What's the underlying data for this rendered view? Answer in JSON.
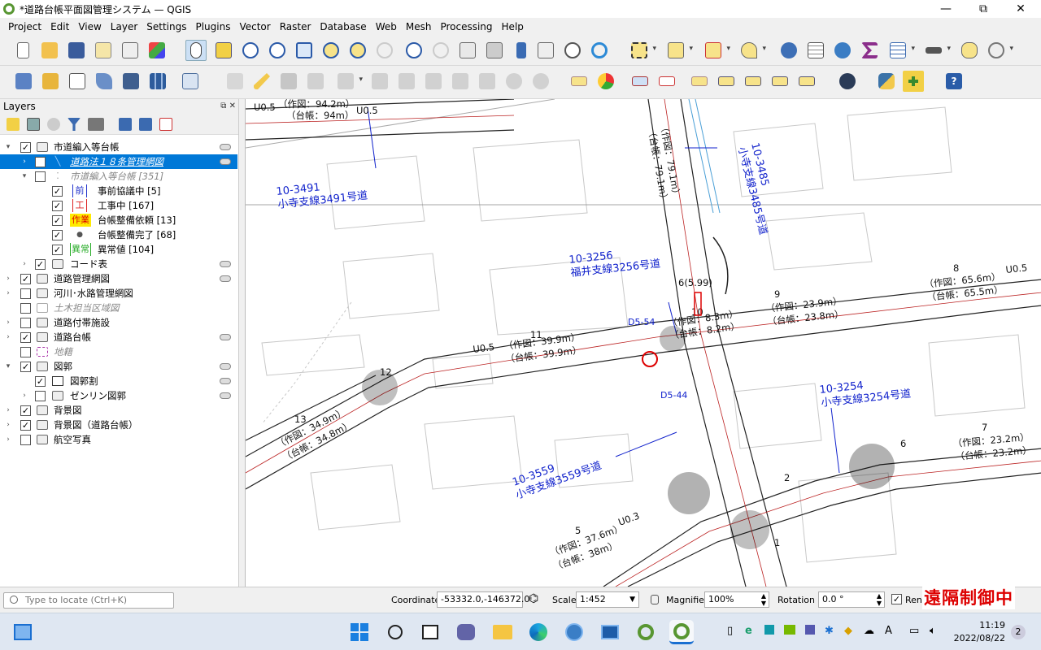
{
  "window": {
    "title": "*道路台帳平面図管理システム — QGIS",
    "minimize": "—",
    "maximize": "⧉",
    "close": "✕"
  },
  "menu": [
    "Project",
    "Edit",
    "View",
    "Layer",
    "Settings",
    "Plugins",
    "Vector",
    "Raster",
    "Database",
    "Web",
    "Mesh",
    "Processing",
    "Help"
  ],
  "layers_panel": {
    "title": "Layers",
    "items": [
      {
        "label": "市道編入等台帳",
        "checked": true
      },
      {
        "label": "道路法１８条管理網図",
        "checked": false
      },
      {
        "label": "市道編入等台帳 [351]",
        "checked": false
      },
      {
        "label": "事前協議中 [5]",
        "checked": true,
        "symbol": "前"
      },
      {
        "label": "工事中 [167]",
        "checked": true,
        "symbol": "工"
      },
      {
        "label": "台帳整備依頼 [13]",
        "checked": true,
        "symbol": "作業"
      },
      {
        "label": "台帳整備完了 [68]",
        "checked": true,
        "symbol": "●"
      },
      {
        "label": "異常値 [104]",
        "checked": true,
        "symbol": "異常"
      },
      {
        "label": "コード表",
        "checked": true
      },
      {
        "label": "道路管理網図",
        "checked": true
      },
      {
        "label": "河川･水路管理網図",
        "checked": false
      },
      {
        "label": "土木担当区域図",
        "checked": false
      },
      {
        "label": "道路付帯施設",
        "checked": false
      },
      {
        "label": "道路台帳",
        "checked": true
      },
      {
        "label": "地籍",
        "checked": false
      },
      {
        "label": "図郭",
        "checked": true
      },
      {
        "label": "図郭割",
        "checked": true
      },
      {
        "label": "ゼンリン図郭",
        "checked": false
      },
      {
        "label": "背景図",
        "checked": true
      },
      {
        "label": "背景図（道路台帳）",
        "checked": true
      },
      {
        "label": "航空写真",
        "checked": false
      }
    ]
  },
  "map": {
    "labels": {
      "road_3491_code": "10-3491",
      "road_3491_name": "小寺支線3491号道",
      "road_3485_code": "10-3485",
      "road_3485_name": "小寺支線3485号道",
      "road_3256_code": "10-3256",
      "road_3256_name": "福井支線3256号道",
      "road_3254_code": "10-3254",
      "road_3254_name": "小寺支線3254号道",
      "road_3559_code": "10-3559",
      "road_3559_name": "小寺支線3559号道",
      "u05_top": "U0.5",
      "sakuzu_94": "（作図：94.2m）",
      "daicho_94": "（台帳：94m）",
      "sakuzu_39": "（作図：39.9m）",
      "daicho_39": "（台帳：39.9m）",
      "u05_mid": "U0.5",
      "sakuzu_23": "（作図：23.9m）",
      "daicho_23": "（台帳：23.8m）",
      "sakuzu_65": "（作図：65.6m）",
      "daicho_65": "（台帳：65.5m）",
      "u05_right": "U0.5",
      "sakuzu_34": "（作図：34.9m）",
      "daicho_34": "（台帳：34.8m）",
      "sakuzu_37": "（作図：37.6m）",
      "daicho_38": "（台帳：38m）",
      "u03": "U0.3",
      "sakuzu_8": "（作図：8.3m）",
      "daicho_8": "（台帳：8.2m）",
      "sakuzu_232": "（作図：23.2m）",
      "daicho_232": "（台帳：23.2m）",
      "sakuzu_79": "（作図：79.1m）",
      "daicho_79": "（台帳：79.1m）",
      "width_599": "6(5.99)",
      "n11": "11",
      "n9": "9",
      "n13": "13",
      "n12": "12",
      "n10": "10",
      "n8": "8",
      "n5": "5",
      "n7": "7",
      "n6": "6",
      "n2": "2",
      "n1": "1",
      "d554": "D5-54",
      "d544": "D5-44"
    }
  },
  "status": {
    "locate_placeholder": "Type to locate (Ctrl+K)",
    "coordinate_label": "Coordinate",
    "coordinate_value": "-53332.0,-146372.0",
    "scale_label": "Scale",
    "scale_value": "1:452",
    "magnifier_label": "Magnifier",
    "magnifier_value": "100%",
    "rotation_label": "Rotation",
    "rotation_value": "0.0 °",
    "render_label": "Ren"
  },
  "overlay_text": "遠隔制御中",
  "clock": {
    "time": "11:19",
    "date": "2022/08/22",
    "badge": "2"
  }
}
